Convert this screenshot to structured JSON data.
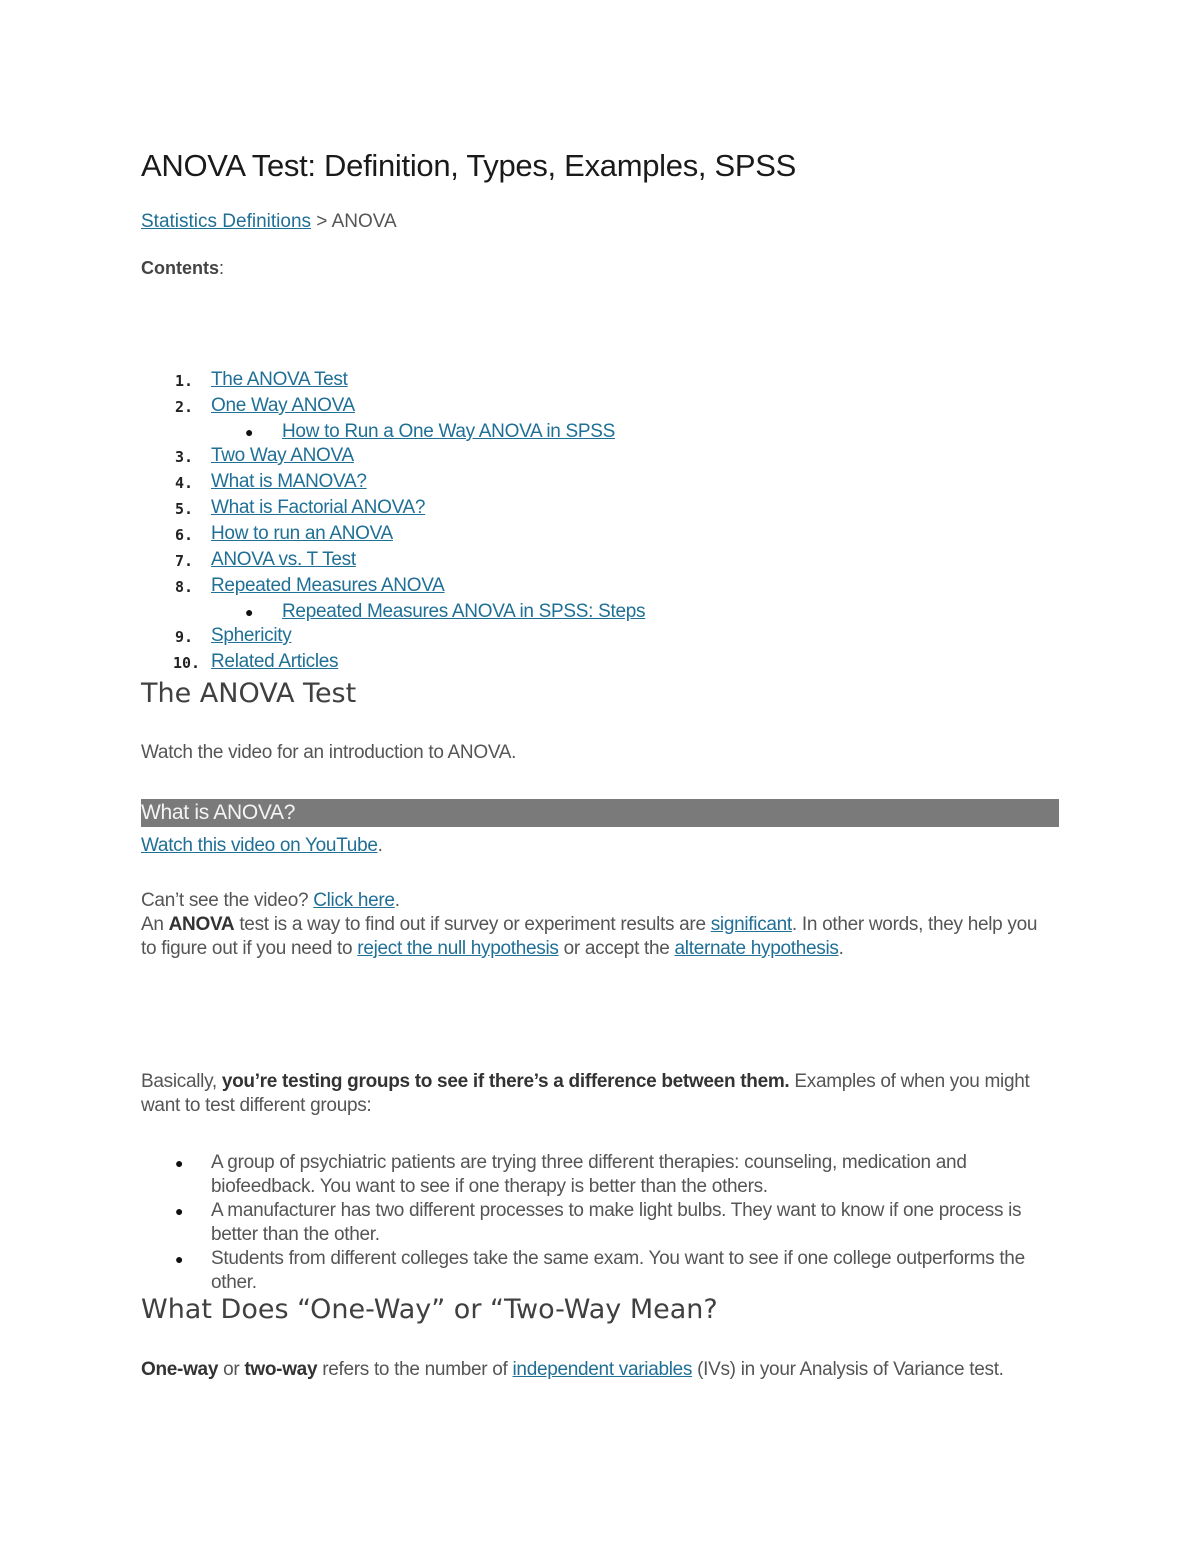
{
  "document": {
    "title": "ANOVA Test: Definition, Types, Examples, SPSS",
    "breadcrumb": {
      "link": "Statistics Definitions",
      "separator": " > ",
      "current": "ANOVA"
    },
    "contents_label": "Contents",
    "contents_colon": ":",
    "toc": [
      {
        "num": "1.",
        "label": "The ANOVA Test"
      },
      {
        "num": "2.",
        "label": "One Way ANOVA",
        "sub": "How to Run a One Way ANOVA in SPSS"
      },
      {
        "num": "3.",
        "label": "Two Way ANOVA"
      },
      {
        "num": "4.",
        "label": "What is MANOVA?"
      },
      {
        "num": "5.",
        "label": "What is Factorial ANOVA?"
      },
      {
        "num": "6.",
        "label": "How to run an ANOVA"
      },
      {
        "num": "7.",
        "label": "ANOVA vs. T Test"
      },
      {
        "num": "8.",
        "label": "Repeated Measures ANOVA",
        "sub": "Repeated Measures ANOVA in SPSS: Steps"
      },
      {
        "num": "9.",
        "label": "Sphericity"
      },
      {
        "num": "10.",
        "label": "Related Articles"
      }
    ],
    "section1": {
      "heading": "The ANOVA Test",
      "intro": "Watch the video for an introduction to ANOVA.",
      "video_bar": "What is ANOVA?",
      "youtube_link": "Watch this video on YouTube",
      "youtube_after": ".",
      "cant_see": "Can’t see the video? ",
      "click_here": "Click here",
      "click_after": ".",
      "para1": {
        "t1": "An ",
        "b1": "ANOVA",
        "t2": " test is a way to find out if survey or experiment results are ",
        "l1": "significant",
        "t3": ". In other words, they help you to figure out if you need to ",
        "l2": "reject the null hypothesis",
        "t4": " or accept the ",
        "l3": "alternate hypothesis",
        "t5": "."
      },
      "para2": {
        "t1": "Basically, ",
        "b1": "you’re testing groups to see if there’s a difference between them.",
        "t2": " Examples of when you might want to test different groups:"
      },
      "examples": [
        "A group of psychiatric patients are trying three different therapies: counseling, medication and biofeedback. You want to see if one therapy is better than the others.",
        "A manufacturer has two different processes to make light bulbs. They want to know if one process is better than the other.",
        "Students from different colleges take the same exam. You want to see if one college outperforms the other."
      ]
    },
    "section2": {
      "heading": "What Does “One-Way” or “Two-Way Mean?",
      "para": {
        "b1": "One-way",
        "t1": " or ",
        "b2": "two-way",
        "t2": " refers to the number of ",
        "l1": "independent variables",
        "t3": " (IVs) in your Analysis of Variance test."
      }
    },
    "colors": {
      "link": "#1f6f96",
      "body_text": "#555555",
      "video_bar_bg": "#7a7a7a"
    }
  }
}
